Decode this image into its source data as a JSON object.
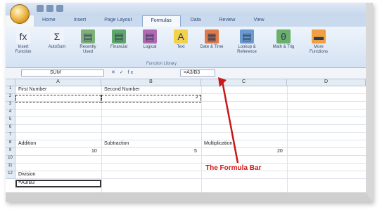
{
  "tabs": [
    "Home",
    "Insert",
    "Page Layout",
    "Formulas",
    "Data",
    "Review",
    "View"
  ],
  "active_tab_index": 3,
  "ribbon": {
    "buttons": [
      {
        "label": "Insert Function",
        "icon": "function-icon",
        "glyph": "fx",
        "color": "#f0f4fa"
      },
      {
        "label": "AutoSum",
        "icon": "autosum-icon",
        "glyph": "Σ",
        "color": "#f0f4fa"
      },
      {
        "label": "Recently Used",
        "icon": "recently-used-icon",
        "glyph": "▤",
        "color": "#7fb07a"
      },
      {
        "label": "Financial",
        "icon": "financial-icon",
        "glyph": "▤",
        "color": "#5fa66a"
      },
      {
        "label": "Logical",
        "icon": "logical-icon",
        "glyph": "▤",
        "color": "#b06ab0"
      },
      {
        "label": "Text",
        "icon": "text-icon",
        "glyph": "A",
        "color": "#f2d24a"
      },
      {
        "label": "Date & Time",
        "icon": "date-time-icon",
        "glyph": "▦",
        "color": "#e07a4a"
      },
      {
        "label": "Lookup & Reference",
        "icon": "lookup-icon",
        "glyph": "▤",
        "color": "#6a9ad0"
      },
      {
        "label": "Math & Trig",
        "icon": "math-trig-icon",
        "glyph": "θ",
        "color": "#6ab06a"
      },
      {
        "label": "More Functions",
        "icon": "more-functions-icon",
        "glyph": "▬",
        "color": "#f0a040"
      }
    ],
    "group_label": "Function Library"
  },
  "formula_bar": {
    "name_box": "SUM",
    "fx_controls": "✕ ✓ fx",
    "formula": "=A3/B3"
  },
  "columns": [
    "A",
    "B",
    "C",
    "D"
  ],
  "rows": [
    "1",
    "2",
    "3",
    "4",
    "5",
    "6",
    "7",
    "8",
    "9",
    "10",
    "11",
    "12"
  ],
  "cells": {
    "a1": "First Number",
    "b1": "Second Number",
    "a6": "Addition",
    "b6": "Subtraction",
    "c6": "Multiplication",
    "a7": "10",
    "b7": "5",
    "c7": "20",
    "a11": "Division",
    "a12": "=A3/B3",
    "b2": "2"
  },
  "annotation": "The Formula Bar",
  "colors": {
    "annotation": "#d01818",
    "accent": "#2f5e9e"
  }
}
